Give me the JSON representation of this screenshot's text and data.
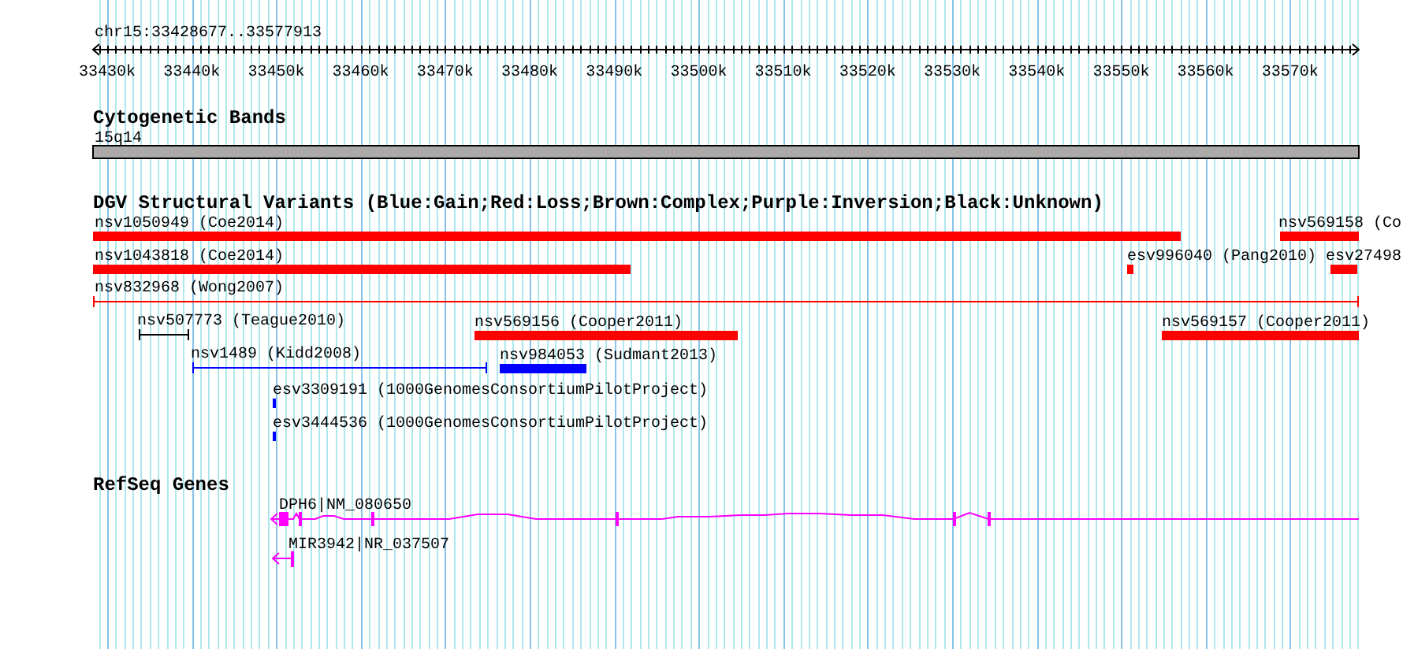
{
  "ruler": {
    "title": "chr15:33428677..33577913",
    "tick_labels": [
      "33430k",
      "33440k",
      "33450k",
      "33460k",
      "33470k",
      "33480k",
      "33490k",
      "33500k",
      "33510k",
      "33520k",
      "33530k",
      "33540k",
      "33550k",
      "33560k",
      "33570k"
    ]
  },
  "tracks": [
    {
      "kind": "cytoband",
      "title": "Cytogenetic Bands",
      "band_label": "15q14"
    },
    {
      "kind": "variants",
      "title": "DGV Structural Variants (Blue:Gain;Red:Loss;Brown:Complex;Purple:Inversion;Black:Unknown)",
      "features": [
        {
          "label": "nsv1050949 (Coe2014)",
          "kind": "block",
          "color": "#ff0000"
        },
        {
          "label": "nsv569158 (Co",
          "kind": "block",
          "color": "#ff0000"
        },
        {
          "label": "nsv1043818 (Coe2014)",
          "kind": "block",
          "color": "#ff0000"
        },
        {
          "label": "esv996040 (Pang2010)",
          "kind": "block",
          "color": "#ff0000"
        },
        {
          "label": "esv27498",
          "kind": "block",
          "color": "#ff0000"
        },
        {
          "label": "nsv832968 (Wong2007)",
          "kind": "span",
          "color": "#ff0000"
        },
        {
          "label": "nsv507773 (Teague2010)",
          "kind": "span",
          "color": "#000000"
        },
        {
          "label": "nsv569156 (Cooper2011)",
          "kind": "block",
          "color": "#ff0000"
        },
        {
          "label": "nsv569157 (Cooper2011)",
          "kind": "block",
          "color": "#ff0000"
        },
        {
          "label": "nsv1489 (Kidd2008)",
          "kind": "span",
          "color": "#0000ff"
        },
        {
          "label": "nsv984053 (Sudmant2013)",
          "kind": "block",
          "color": "#0000ff"
        },
        {
          "label": "esv3309191 (1000GenomesConsortiumPilotProject)",
          "kind": "block",
          "color": "#0000ff"
        },
        {
          "label": "esv3444536 (1000GenomesConsortiumPilotProject)",
          "kind": "block",
          "color": "#0000ff"
        }
      ]
    },
    {
      "kind": "genes",
      "title": "RefSeq Genes",
      "genes": [
        {
          "label": "DPH6|NM_080650"
        },
        {
          "label": "MIR3942|NR_037507"
        }
      ]
    }
  ]
}
